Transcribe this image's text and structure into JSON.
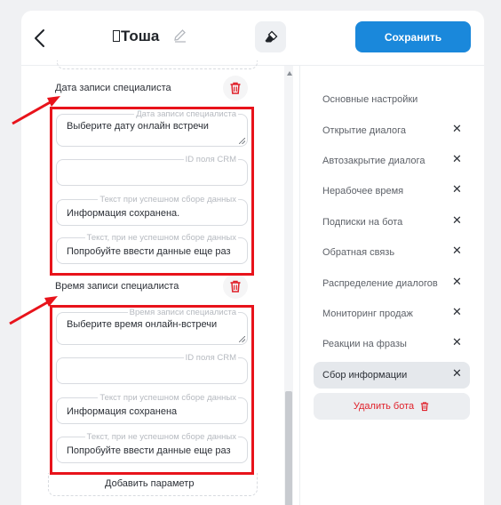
{
  "header": {
    "bot_name": "Тоша",
    "save_label": "Сохранить"
  },
  "form": {
    "section_date": {
      "title": "Дата записи специалиста",
      "fields": [
        {
          "legend": "Дата записи специалиста",
          "value": "Выберите дату онлайн встречи"
        },
        {
          "legend": "ID поля CRM",
          "value": ""
        },
        {
          "legend": "Текст при успешном сборе данных",
          "value": "Информация сохранена."
        },
        {
          "legend": "Текст, при не успешном сборе данных",
          "value": "Попробуйте ввести данные еще раз"
        }
      ]
    },
    "section_time": {
      "title": "Время записи специалиста",
      "fields": [
        {
          "legend": "Время записи специалиста",
          "value": "Выберите время онлайн-встречи"
        },
        {
          "legend": "ID поля CRM",
          "value": ""
        },
        {
          "legend": "Текст при успешном сборе данных",
          "value": "Информация сохранена"
        },
        {
          "legend": "Текст, при не успешном сборе данных",
          "value": "Попробуйте ввести данные еще раз"
        }
      ]
    },
    "add_param_label": "Добавить параметр"
  },
  "nav": {
    "items": [
      {
        "label": "Основные настройки"
      },
      {
        "label": "Открытие диалога"
      },
      {
        "label": "Автозакрытие диалога"
      },
      {
        "label": "Нерабочее время"
      },
      {
        "label": "Подписки на бота"
      },
      {
        "label": "Обратная связь"
      },
      {
        "label": "Распределение диалогов"
      },
      {
        "label": "Мониторинг продаж"
      },
      {
        "label": "Реакции на фразы"
      },
      {
        "label": "Сбор информации"
      }
    ],
    "active": "Сбор информации",
    "delete_label": "Удалить бота"
  },
  "colors": {
    "accent": "#1a88db",
    "danger": "#e0202a",
    "annotation": "#e8131b"
  }
}
